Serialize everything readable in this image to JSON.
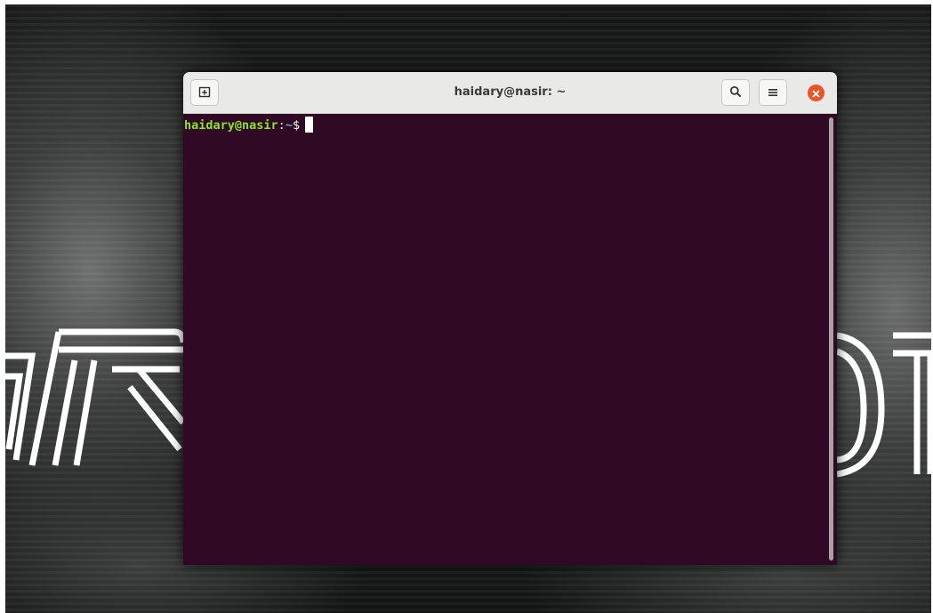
{
  "window": {
    "title": "haidary@nasir: ~"
  },
  "headerbar": {
    "new_tab_icon": "new-tab-icon",
    "search_icon": "search-icon",
    "menu_icon": "hamburger-menu-icon",
    "close_icon": "close-icon"
  },
  "terminal": {
    "prompt_user": "haidary@nasir",
    "prompt_separator": ":",
    "prompt_path": "~",
    "prompt_symbol": "$"
  },
  "colors": {
    "terminal_background": "#300a24",
    "prompt_user": "#8ae234",
    "prompt_path": "#729fcf",
    "close_button": "#e9542a",
    "headerbar": "#e9e9e7"
  },
  "desktop": {
    "wallpaper_logo_text": "MR. ROBOT"
  }
}
